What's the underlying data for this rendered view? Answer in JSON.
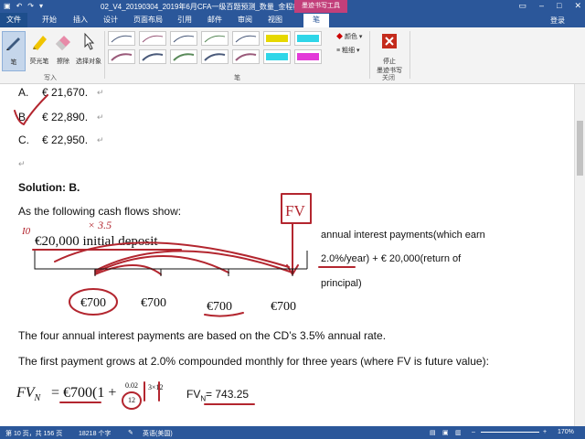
{
  "titlebar": {
    "title": "02_V4_20190304_2019年6月CFA一级百题预测_数量_金程教育...",
    "context_tab": "墨迹书写工具",
    "quick_access": [
      "save-icon",
      "undo-icon",
      "redo-icon",
      "customize-icon"
    ]
  },
  "tabs": [
    "文件",
    "开始",
    "插入",
    "设计",
    "页面布局",
    "引用",
    "邮件",
    "审阅",
    "视图",
    "笔"
  ],
  "login": "登录",
  "ribbon": {
    "tools": [
      {
        "label": "笔",
        "icon": "pen-icon"
      },
      {
        "label": "荧光笔",
        "icon": "highlighter-icon"
      },
      {
        "label": "擦除",
        "icon": "eraser-icon"
      },
      {
        "label": "选择对象",
        "icon": "select-objects-icon"
      }
    ],
    "group_write": "写入",
    "group_pen": "笔",
    "color_label": "颜色",
    "thickness_label": "粗细",
    "stop_label_1": "停止",
    "stop_label_2": "墨迹书写",
    "group_close": "关闭",
    "pen_colors": [
      "#4a5a7a",
      "#8a8a8a",
      "#9a5a7a",
      "#3a5a9a",
      "#5a8a5a",
      "#e6d800",
      "#2fd6e8",
      "#e33ad8"
    ]
  },
  "document": {
    "option_a_letter": "A.",
    "option_a_value": "€ 21,670.",
    "option_b_letter": "B.",
    "option_b_value": "€ 22,890.",
    "option_c_letter": "C.",
    "option_c_value": "€ 22,950.",
    "solution": "Solution: B.",
    "intro": "As the following cash flows show:",
    "initial_deposit": "€20,000 initial deposit",
    "flows": [
      "€700",
      "€700",
      "€700",
      "€700"
    ],
    "side_line1": "annual interest payments(which earn",
    "side_line2": "2.0%/year) +  € 20,000(return of",
    "side_line3": "principal)",
    "para1": "The four annual interest payments are based on the CD’s 3.5% annual rate.",
    "para2": "The first payment grows at 2.0% compounded monthly for three years (where FV is future value):",
    "formula_lhs": "FV",
    "formula_sub": "N",
    "formula_eq": "= €700(1 +",
    "frac_num": "0.02",
    "frac_den": "12",
    "formula_exp": "3×12",
    "fv_label": "FV",
    "fv_sub": "N",
    "fv_result": "= 743.25"
  },
  "handwriting": {
    "io": "I0",
    "mult": "× 3.5",
    "fv_box": "FV"
  },
  "statusbar": {
    "page": "第 10 页，共 156 页",
    "words": "18218 个字",
    "lang": "英语(美国)",
    "zoom": "170%"
  }
}
